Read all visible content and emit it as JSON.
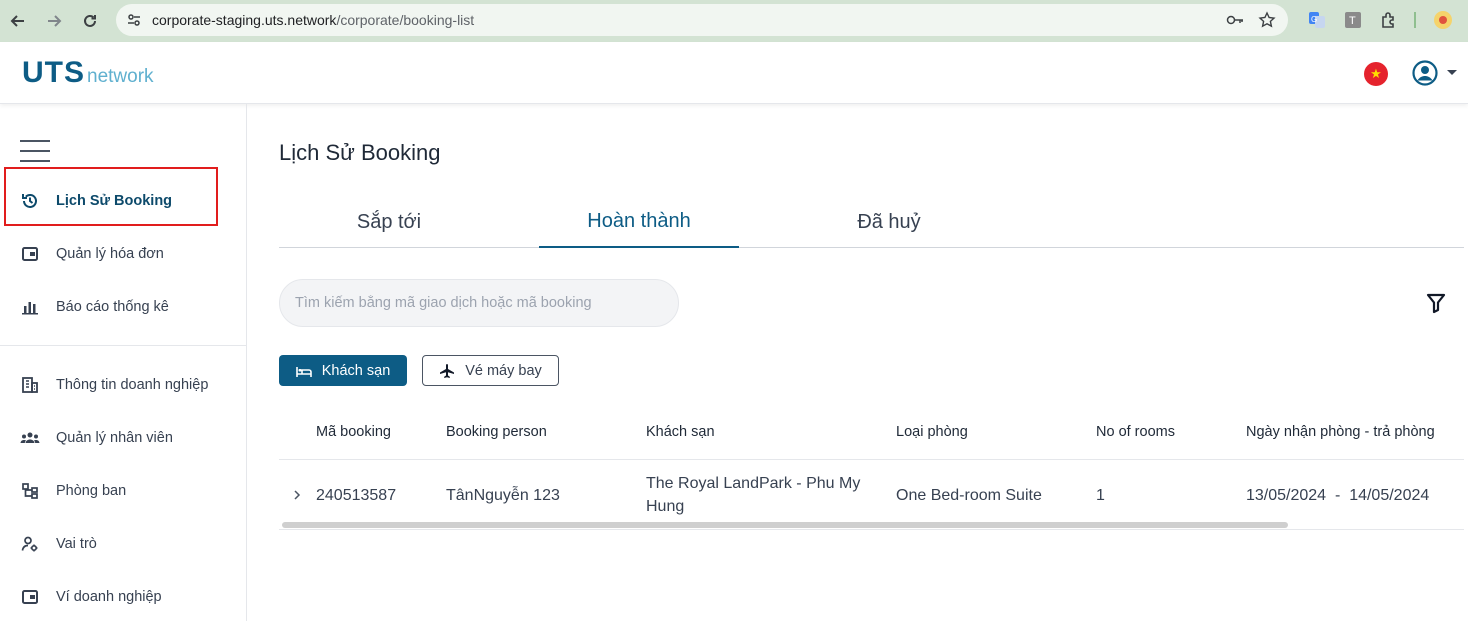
{
  "browser": {
    "url_host": "corporate-staging.uts.network",
    "url_path": "/corporate/booking-list"
  },
  "header": {
    "logo_main": "UTS",
    "logo_sub": "network"
  },
  "sidebar": {
    "items": [
      {
        "label": "Lịch Sử Booking",
        "icon": "history-icon",
        "active": true
      },
      {
        "label": "Quản lý hóa đơn",
        "icon": "wallet-icon"
      },
      {
        "label": "Báo cáo thống kê",
        "icon": "bar-chart-icon"
      },
      {
        "label": "Thông tin doanh nghiệp",
        "icon": "building-icon"
      },
      {
        "label": "Quản lý nhân viên",
        "icon": "group-icon"
      },
      {
        "label": "Phòng ban",
        "icon": "org-chart-icon"
      },
      {
        "label": "Vai trò",
        "icon": "user-gear-icon"
      },
      {
        "label": "Ví doanh nghiệp",
        "icon": "wallet-icon"
      }
    ]
  },
  "main": {
    "title": "Lịch Sử Booking",
    "tabs": [
      {
        "label": "Sắp tới"
      },
      {
        "label": "Hoàn thành",
        "active": true
      },
      {
        "label": "Đã huỷ"
      }
    ],
    "search_placeholder": "Tìm kiếm bằng mã giao dịch hoặc mã booking",
    "type_buttons": {
      "hotel": "Khách sạn",
      "flight": "Vé máy bay"
    },
    "table": {
      "columns": [
        "Mã booking",
        "Booking person",
        "Khách sạn",
        "Loại phòng",
        "No of rooms",
        "Ngày nhận phòng - trả phòng"
      ],
      "rows": [
        {
          "code": "240513587",
          "person": "TânNguyễn 123",
          "hotel": "The Royal LandPark - Phu My Hung",
          "room_type": "One Bed-room Suite",
          "rooms": "1",
          "dates": "13/05/2024  -  14/05/2024"
        }
      ]
    }
  },
  "colors": {
    "brand": "#0d5c85",
    "brand_light": "#5fb0cf",
    "highlight": "#e11d1d"
  }
}
